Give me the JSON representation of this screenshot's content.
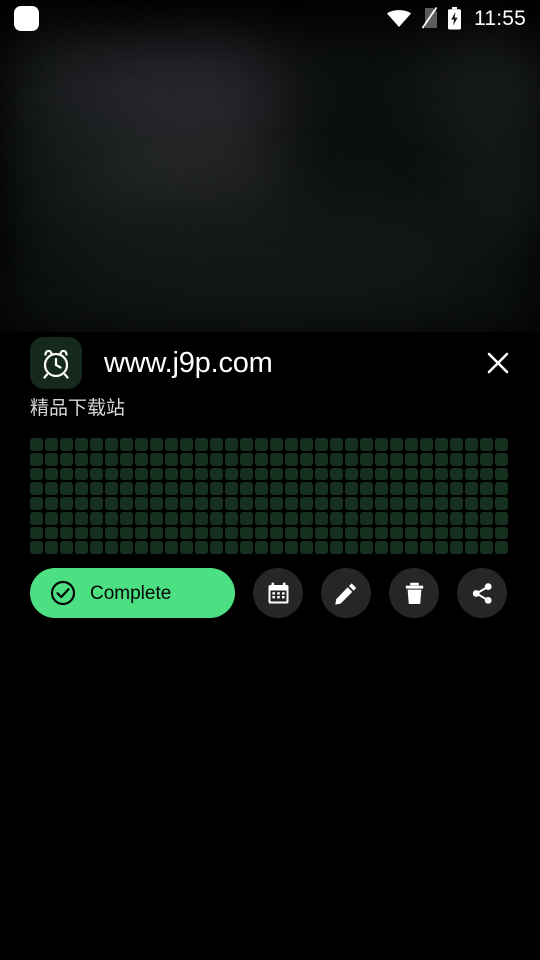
{
  "statusbar": {
    "notification_icon": "rounded-square-notification-icon",
    "wifi_icon": "wifi-icon",
    "sim_icon": "no-sim-card-icon",
    "battery_icon": "battery-charging-icon",
    "time": "11:55"
  },
  "notification": {
    "app_icon": "alarm-clock-icon",
    "title": "www.j9p.com",
    "subtitle": "精品下载站",
    "close_icon": "close-icon",
    "obscured_content": {
      "columns": 32,
      "rows": 8,
      "block_color": "#16301f"
    },
    "actions": {
      "complete": {
        "label": "Complete",
        "icon": "check-circle-icon",
        "color": "#4ce083"
      },
      "buttons": [
        {
          "name": "snooze-button",
          "icon": "calendar-icon"
        },
        {
          "name": "edit-button",
          "icon": "pencil-icon"
        },
        {
          "name": "delete-button",
          "icon": "trash-icon"
        },
        {
          "name": "share-button",
          "icon": "share-icon"
        }
      ]
    }
  },
  "theme": {
    "background": "#000000",
    "accent": "#4ce083",
    "app_icon_bg": "#15291c",
    "button_bg": "#262626",
    "title_color": "#ffffff",
    "subtitle_color": "#d6d6d6"
  }
}
